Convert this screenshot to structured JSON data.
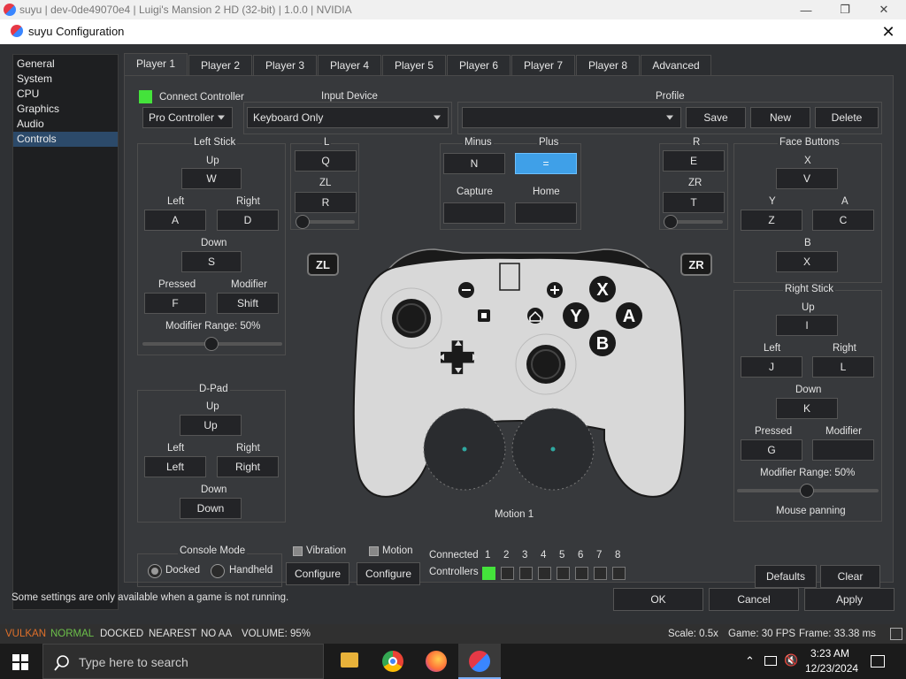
{
  "window": {
    "title": "suyu | dev-0de49070e4 | Luigi's Mansion 2 HD (32-bit) | 1.0.0 | NVIDIA"
  },
  "dialog": {
    "title": "suyu Configuration"
  },
  "sidebar": {
    "items": [
      {
        "label": "General"
      },
      {
        "label": "System"
      },
      {
        "label": "CPU"
      },
      {
        "label": "Graphics"
      },
      {
        "label": "Audio"
      },
      {
        "label": "Controls"
      }
    ]
  },
  "tabs": [
    "Player 1",
    "Player 2",
    "Player 3",
    "Player 4",
    "Player 5",
    "Player 6",
    "Player 7",
    "Player 8",
    "Advanced"
  ],
  "top": {
    "connect_controller": "Connect Controller",
    "controller_type": "Pro Controller",
    "input_device_label": "Input Device",
    "input_device": "Keyboard Only",
    "profile_label": "Profile",
    "profile_value": "",
    "save": "Save",
    "new": "New",
    "delete": "Delete"
  },
  "left_stick": {
    "title": "Left Stick",
    "up_label": "Up",
    "up": "W",
    "left_label": "Left",
    "left": "A",
    "right_label": "Right",
    "right": "D",
    "down_label": "Down",
    "down": "S",
    "pressed_label": "Pressed",
    "pressed": "F",
    "modifier_label": "Modifier",
    "modifier": "Shift",
    "modifier_range": "Modifier Range: 50%",
    "modifier_range_value": 0.5
  },
  "shoulders_left": {
    "l_label": "L",
    "l": "Q",
    "zl_label": "ZL",
    "zl": "R",
    "zl_threshold": 0.05
  },
  "shoulders_right": {
    "r_label": "R",
    "r": "E",
    "zr_label": "ZR",
    "zr": "T",
    "zr_threshold": 0.05
  },
  "center_buttons": {
    "minus_label": "Minus",
    "minus": "N",
    "plus_label": "Plus",
    "plus": "=",
    "capture_label": "Capture",
    "capture": "",
    "home_label": "Home",
    "home": ""
  },
  "face_buttons": {
    "title": "Face Buttons",
    "x_label": "X",
    "x": "V",
    "y_label": "Y",
    "y": "Z",
    "a_label": "A",
    "a": "C",
    "b_label": "B",
    "b": "X"
  },
  "right_stick": {
    "title": "Right Stick",
    "up_label": "Up",
    "up": "I",
    "left_label": "Left",
    "left": "J",
    "right_label": "Right",
    "right": "L",
    "down_label": "Down",
    "down": "K",
    "pressed_label": "Pressed",
    "pressed": "G",
    "modifier_label": "Modifier",
    "modifier": "",
    "modifier_range": "Modifier Range: 50%",
    "modifier_range_value": 0.5,
    "mouse_panning": "Mouse panning"
  },
  "dpad": {
    "title": "D-Pad",
    "up_label": "Up",
    "up": "Up",
    "left_label": "Left",
    "left": "Left",
    "right_label": "Right",
    "right": "Right",
    "down_label": "Down",
    "down": "Down"
  },
  "controller_image": {
    "zl": "ZL",
    "zr": "ZR",
    "x": "X",
    "y": "Y",
    "a": "A",
    "b": "B",
    "motion": "Motion 1"
  },
  "bottom": {
    "console_mode": "Console Mode",
    "docked": "Docked",
    "handheld": "Handheld",
    "vibration": "Vibration",
    "motion": "Motion",
    "configure": "Configure",
    "connected_label": "Connected",
    "controllers_label": "Controllers",
    "slots": [
      "1",
      "2",
      "3",
      "4",
      "5",
      "6",
      "7",
      "8"
    ],
    "connected_states": [
      true,
      false,
      false,
      false,
      false,
      false,
      false,
      false
    ],
    "defaults": "Defaults",
    "clear": "Clear"
  },
  "footer": {
    "note": "Some settings are only available when a game is not running.",
    "ok": "OK",
    "cancel": "Cancel",
    "apply": "Apply"
  },
  "statusbar": {
    "api": "VULKAN",
    "mode": "NORMAL",
    "dock": "DOCKED",
    "filter": "NEAREST",
    "aa": "NO AA",
    "volume": "VOLUME: 95%",
    "scale": "Scale: 0.5x",
    "game_fps": "Game: 30 FPS",
    "frame": "Frame: 33.38 ms"
  },
  "taskbar": {
    "search_placeholder": "Type here to search",
    "time": "3:23 AM",
    "date": "12/23/2024"
  },
  "colors": {
    "accent": "#3fa0e8",
    "connected": "#44e33b",
    "vulkan": "#e0702a",
    "normal": "#6cc04a"
  }
}
